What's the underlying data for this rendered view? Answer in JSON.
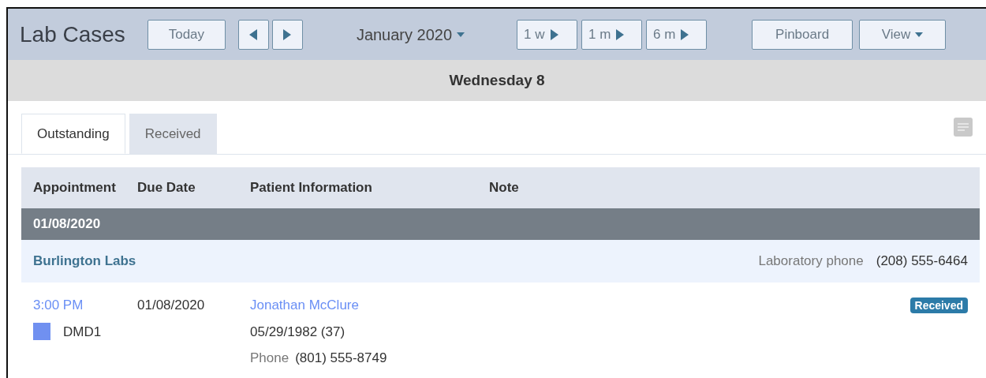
{
  "header": {
    "title": "Lab Cases",
    "today": "Today",
    "month": "January 2020",
    "ranges": [
      "1 w",
      "1 m",
      "6 m"
    ],
    "pinboard": "Pinboard",
    "view": "View"
  },
  "day": "Wednesday 8",
  "tabs": [
    {
      "label": "Outstanding",
      "selected": true
    },
    {
      "label": "Received",
      "selected": false
    }
  ],
  "table": {
    "columns": [
      "Appointment",
      "Due Date",
      "Patient Information",
      "Note"
    ],
    "groups": [
      {
        "date": "01/08/2020",
        "labs": [
          {
            "name": "Burlington Labs",
            "phone_label": "Laboratory phone",
            "phone": "(208) 555-6464",
            "cases": [
              {
                "time": "3:00 PM",
                "provider": "DMD1",
                "color": "#7090f0",
                "due": "01/08/2020",
                "patient": "Jonathan McClure",
                "birth": "05/29/1982 (37)",
                "phone_label": "Phone",
                "phone": "(801) 555-8749",
                "status": "Received"
              }
            ]
          }
        ]
      }
    ]
  }
}
